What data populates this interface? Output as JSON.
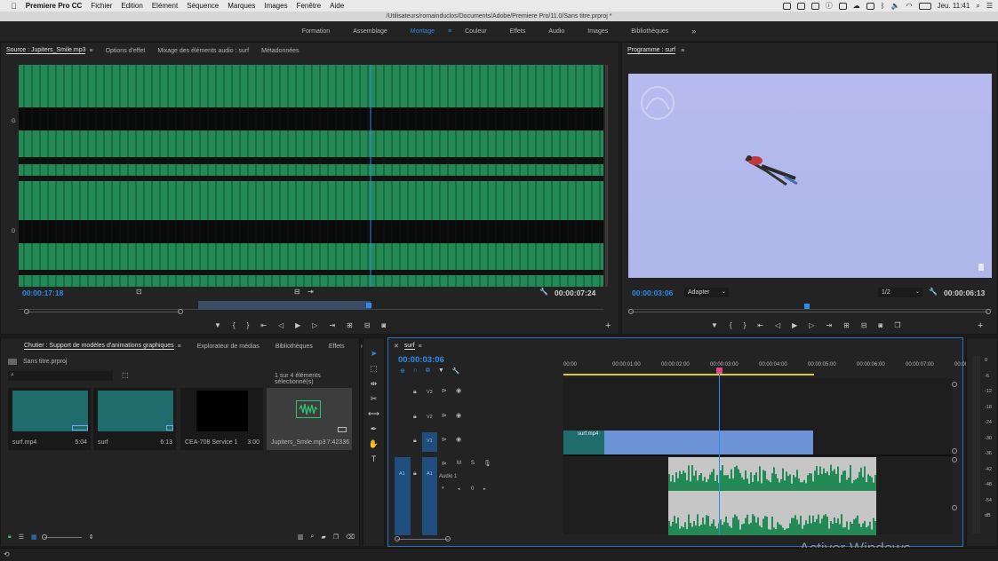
{
  "menubar": {
    "apple": "",
    "app_name": "Premiere Pro CC",
    "items": [
      "Fichier",
      "Edition",
      "Elément",
      "Séquence",
      "Marques",
      "Images",
      "Fenêtre",
      "Aide"
    ],
    "clock": "Jeu. 11:41"
  },
  "title_path": "/Utilisateurs/romainduclos/Documents/Adobe/Premiere Pro/11.0/Sans titre.prproj *",
  "workspaces": {
    "items": [
      "Formation",
      "Assemblage",
      "Montage",
      "Couleur",
      "Effets",
      "Audio",
      "Images",
      "Bibliothèques"
    ],
    "active": "Montage",
    "overflow": "»"
  },
  "source": {
    "tab_source": "Source : Jupiters_Smile.mp3",
    "tab_effects": "Options d'effet",
    "tab_mixer": "Mixage des éléments audio : surf",
    "tab_meta": "Métadonnées",
    "menu_glyph": "≡",
    "channel_top": "G",
    "channel_bottom": "D",
    "tc_in": "00:00:17:18",
    "tc_dur": "00:00:07:24",
    "controls": [
      "▼",
      "{",
      "}",
      "⇤",
      "◁",
      "▶",
      "▷",
      "⇥"
    ],
    "add": "+"
  },
  "program": {
    "tab": "Programme : surf",
    "menu_glyph": "≡",
    "tc_in": "00:00:03:06",
    "fit": "Adapter",
    "resolution": "1/2",
    "tc_dur": "00:00:06:13",
    "controls": [
      "▼",
      "{",
      "}",
      "⇤",
      "◁",
      "▶",
      "▷",
      "⇥"
    ],
    "add": "+"
  },
  "project": {
    "tab_bin": "Chutier : Support de modèles d'animations graphiques",
    "tab_explorer": "Explorateur de médias",
    "tab_libraries": "Bibliothèques",
    "tab_effects": "Effets",
    "overflow": "»",
    "menu_glyph": "≡",
    "project_name": "Sans titre.prproj",
    "selection_count": "1 sur 4 éléments sélectionné(s)",
    "items": [
      {
        "name": "surf.mp4",
        "duration": "5:04"
      },
      {
        "name": "surf",
        "duration": "6:13"
      },
      {
        "name": "CEA-708 Service 1",
        "duration": "3:00"
      },
      {
        "name": "Jupiters_Smile.mp3",
        "duration": "7:42336"
      }
    ]
  },
  "timeline": {
    "tab": "surf",
    "menu_glyph": "≡",
    "timecode": "00:00:03:06",
    "ruler": [
      "00:00",
      "00:00:01:00",
      "00:00:02:00",
      "00:00:03:00",
      "00:00:04:00",
      "00:00:05:00",
      "00:00:06:00",
      "00:00:07:00",
      "00:00"
    ],
    "tracks_video": [
      "V3",
      "V2",
      "V1"
    ],
    "tracks_audio": [
      "A1"
    ],
    "audio_label": "Audio 1",
    "source_patch_audio": "A1",
    "clip_video": "surf.mp4",
    "track_letters": {
      "m": "M",
      "s": "S"
    },
    "pan_value": "0"
  },
  "meter": {
    "ticks": [
      "0",
      "-6",
      "-12",
      "-18",
      "-24",
      "-30",
      "-36",
      "-42",
      "-48",
      "-54",
      "dB"
    ]
  },
  "watermark": "Activer Windows",
  "colors": {
    "accent": "#2d8ceb",
    "waveform": "#238a55",
    "sky": "#b3b9ed",
    "video_clip": "#6c93d6",
    "audio_clip": "#c6c6c6"
  }
}
